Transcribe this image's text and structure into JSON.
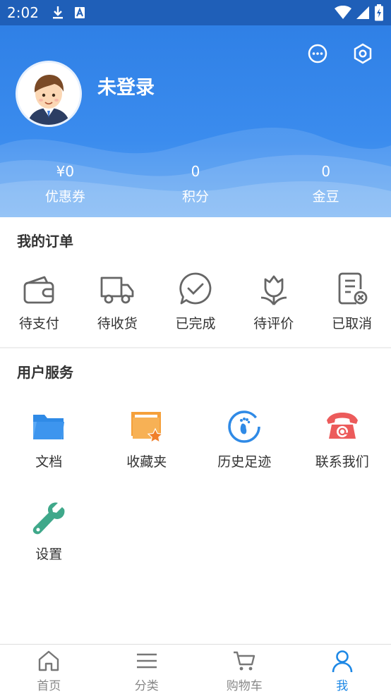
{
  "status_bar": {
    "time": "2:02",
    "icons": [
      "download-icon",
      "a-badge-icon",
      "wifi-icon",
      "signal-icon",
      "battery-icon"
    ]
  },
  "header": {
    "username": "未登录",
    "icons": [
      "message-icon",
      "settings-icon"
    ],
    "stats": [
      {
        "value": "¥0",
        "label": "优惠券"
      },
      {
        "value": "0",
        "label": "积分"
      },
      {
        "value": "0",
        "label": "金豆"
      }
    ]
  },
  "orders": {
    "title": "我的订单",
    "items": [
      {
        "label": "待支付",
        "icon": "wallet-icon"
      },
      {
        "label": "待收货",
        "icon": "truck-icon"
      },
      {
        "label": "已完成",
        "icon": "check-bubble-icon"
      },
      {
        "label": "待评价",
        "icon": "flower-icon"
      },
      {
        "label": "已取消",
        "icon": "cancelled-doc-icon"
      }
    ]
  },
  "services": {
    "title": "用户服务",
    "items": [
      {
        "label": "文档",
        "icon": "folder-icon"
      },
      {
        "label": "收藏夹",
        "icon": "favorite-folder-icon"
      },
      {
        "label": "历史足迹",
        "icon": "footprint-icon"
      },
      {
        "label": "联系我们",
        "icon": "phone-icon"
      },
      {
        "label": "设置",
        "icon": "wrench-icon"
      }
    ]
  },
  "bottom_nav": {
    "items": [
      {
        "label": "首页",
        "icon": "home-icon"
      },
      {
        "label": "分类",
        "icon": "category-icon"
      },
      {
        "label": "购物车",
        "icon": "cart-icon"
      },
      {
        "label": "我",
        "icon": "user-icon",
        "active": true
      }
    ]
  },
  "colors": {
    "primary": "#2f80e6",
    "active_tab": "#1e88e5",
    "icon_gray": "#666666",
    "folder_blue": "#2f8ae6",
    "folder_orange": "#f5a03a",
    "phone_red": "#ec5b5b",
    "wrench_green": "#3fa88a"
  }
}
